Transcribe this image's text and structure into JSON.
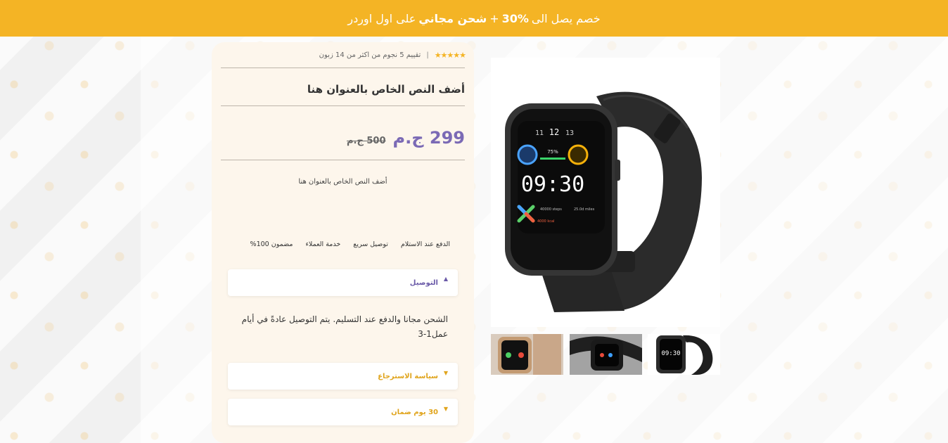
{
  "banner": {
    "text_before": "خصم يصل الى",
    "discount": "30%",
    "plus": "+",
    "shipping": "شحن مجاني",
    "text_after": "على اول اوردر"
  },
  "product": {
    "stars": "★★★★★",
    "rating_text": "تقييم 5 نجوم من اكثر من 14 زبون",
    "rating_separator": "|",
    "title": "أضف النص الخاص بالعنوان هنا",
    "price_new": "299 ج.م",
    "price_old": "500 ج.م",
    "subtitle": "أضف النص الخاص بالعنوان هنا"
  },
  "features": [
    "الدفع عند الاستلام",
    "توصيل سريع",
    "خدمة العملاء",
    "مضمون 100%"
  ],
  "accordion": {
    "delivery": {
      "label": "التوصيل",
      "body": "الشحن مجانا والدفع عند التسليم.  يتم التوصيل عادةً في أيام عمل1-3"
    },
    "returns": {
      "label": "سياسة الاسترجاع"
    },
    "warranty": {
      "label": "30 يوم ضمان"
    }
  },
  "watch_face": {
    "date_left": "11",
    "date_mid": "12",
    "date_right": "13",
    "battery": "75%",
    "time": "09:30",
    "steps": "40000 steps",
    "distance": "25.0d miles",
    "kcal": "4000 kcal"
  },
  "thumb_time": "09:30",
  "colors": {
    "banner": "#f4b425",
    "price": "#7b6ab5",
    "accordion_open": "#6a5aa8",
    "accordion_closed": "#e0a41c"
  },
  "icons": [
    "star-icon",
    "caret-up-icon",
    "caret-down-icon"
  ]
}
